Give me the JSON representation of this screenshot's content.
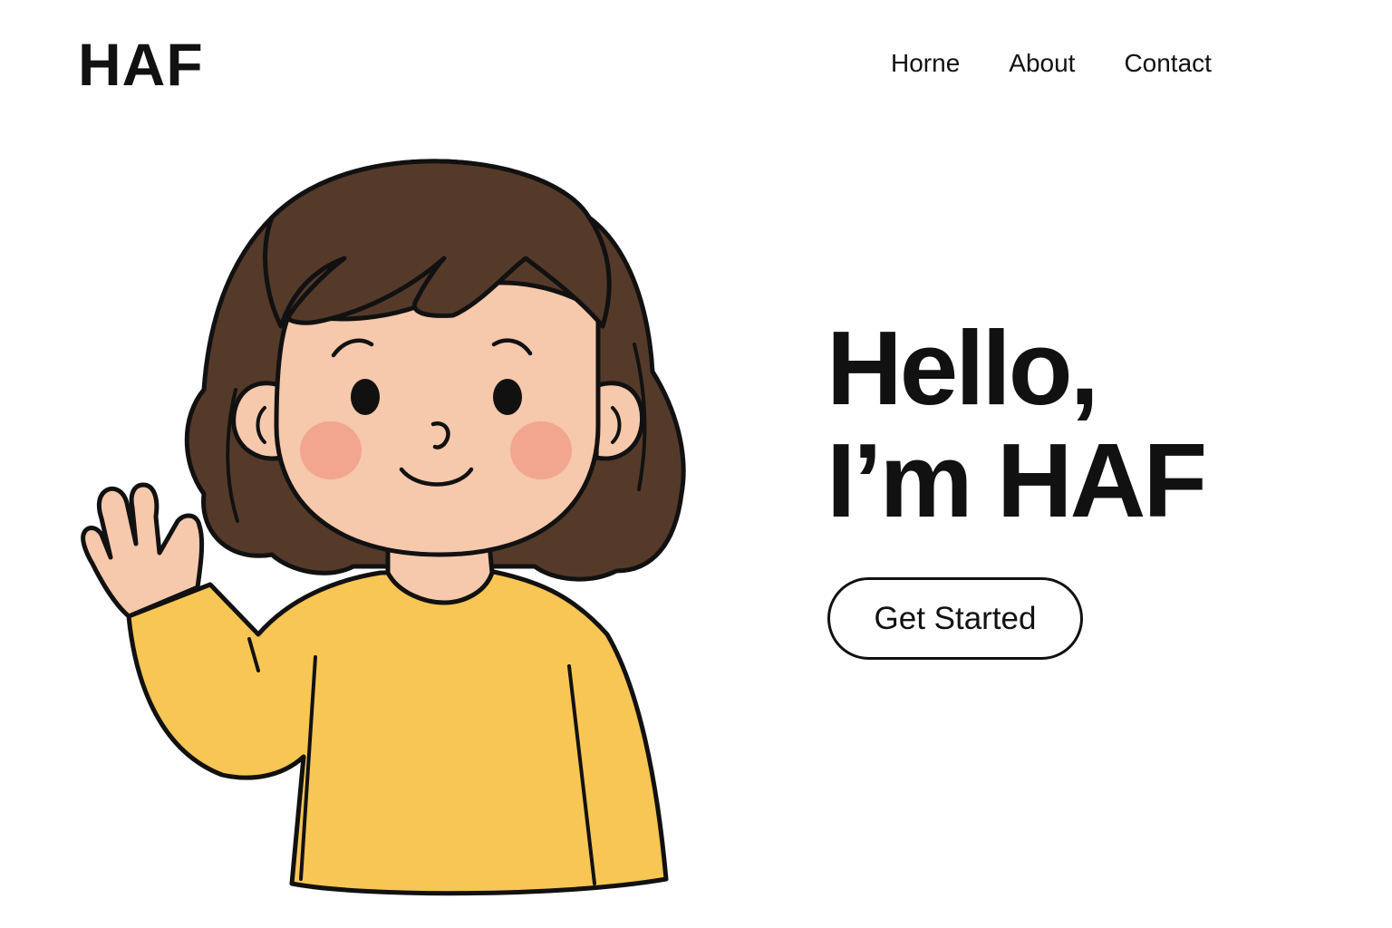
{
  "header": {
    "logo": "HAF",
    "nav": [
      {
        "label": "Horne"
      },
      {
        "label": "About"
      },
      {
        "label": "Contact"
      }
    ]
  },
  "hero": {
    "title_line1": "Hello,",
    "title_line2": "I’m HAF",
    "cta_label": "Get Started"
  },
  "illustration": {
    "subject": "waving-girl-icon",
    "colors": {
      "hair": "#553a2a",
      "skin": "#f6c8ac",
      "cheeks": "#f2a58f",
      "sweater": "#f7c654",
      "outline": "#111111"
    }
  }
}
